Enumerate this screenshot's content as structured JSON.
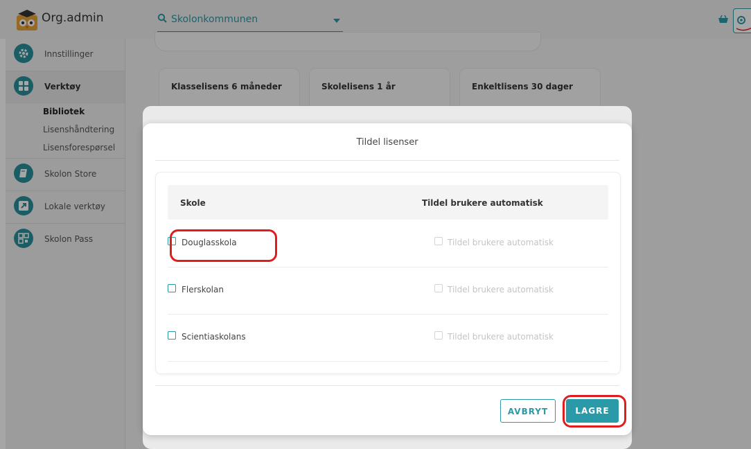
{
  "app": {
    "title": "Org.admin"
  },
  "school_select": {
    "value": "Skolonkommunen"
  },
  "sidebar": {
    "items": [
      {
        "label": "Innstillinger",
        "icon": "gear-icon"
      },
      {
        "label": "Verktøy",
        "icon": "grid-icon"
      },
      {
        "label": "Skolon Store",
        "icon": "book-icon"
      },
      {
        "label": "Lokale verktøy",
        "icon": "arrow-box-icon"
      },
      {
        "label": "Skolon Pass",
        "icon": "qr-icon"
      }
    ],
    "subitems": [
      {
        "label": "Bibliotek"
      },
      {
        "label": "Lisenshåndtering"
      },
      {
        "label": "Lisensforespørsel"
      }
    ]
  },
  "license_cards": [
    {
      "label": "Klasselisens 6 måneder"
    },
    {
      "label": "Skolelisens 1 år"
    },
    {
      "label": "Enkeltlisens 30 dager"
    }
  ],
  "modal": {
    "title": "Tildel lisenser",
    "columns": {
      "school": "Skole",
      "auto": "Tildel brukere automatisk"
    },
    "rows": [
      {
        "school": "Douglasskola",
        "auto": "Tildel brukere automatisk"
      },
      {
        "school": "Flerskolan",
        "auto": "Tildel brukere automatisk"
      },
      {
        "school": "Scientiaskolans",
        "auto": "Tildel brukere automatisk"
      }
    ],
    "buttons": {
      "cancel": "AVBRYT",
      "save": "LAGRE"
    }
  },
  "colors": {
    "accent": "#2a9aa8",
    "highlight": "#e01d1d",
    "sidebar_icon": "#2a8f9c"
  }
}
